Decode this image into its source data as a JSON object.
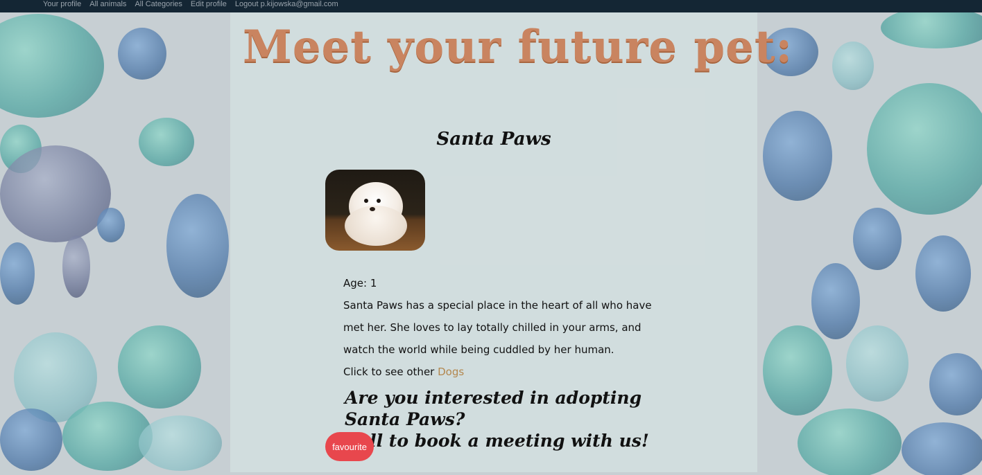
{
  "nav": {
    "items": [
      {
        "label": "Your profile"
      },
      {
        "label": "All animals"
      },
      {
        "label": "All Categories"
      },
      {
        "label": "Edit profile"
      },
      {
        "label": "Logout p.kijowska@gmail.com"
      }
    ]
  },
  "page": {
    "heading": "Meet your future pet:",
    "pet_name": "Santa Paws",
    "age_label": "Age: 1",
    "description": "Santa Paws has a special place in the heart of all who have met her. She loves to lay totally chilled in your arms, and watch the world while being cuddled by her human.",
    "other_prefix": "Click to see other",
    "other_link": "Dogs",
    "adopt_line1": "Are you interested in adopting Santa Paws?",
    "adopt_line2": "Call to book a meeting with us!",
    "favourite_label": "favourite"
  },
  "colors": {
    "nav_bg": "#142634",
    "heading": "#c98460",
    "link": "#b3874e",
    "favourite_button": "#e8474d"
  }
}
